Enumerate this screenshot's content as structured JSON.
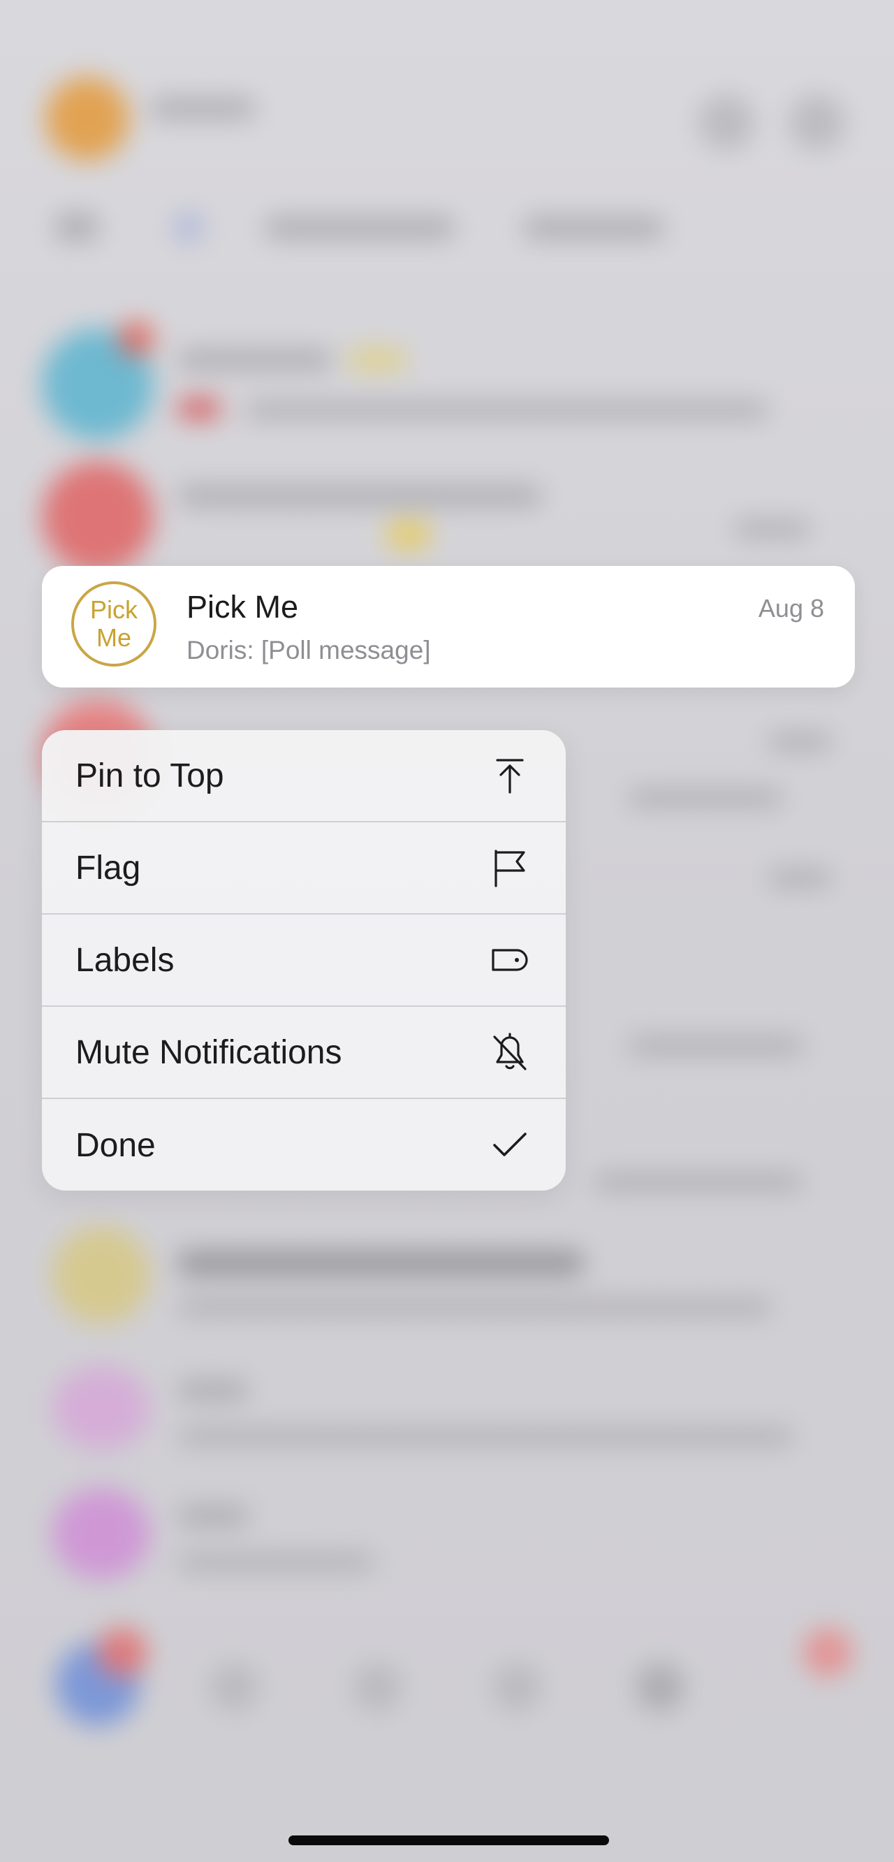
{
  "preview": {
    "avatar_line1": "Pick",
    "avatar_line2": "Me",
    "name": "Pick Me",
    "date": "Aug 8",
    "subtitle": "Doris: [Poll message]"
  },
  "menu": {
    "items": [
      {
        "label": "Pin to Top",
        "icon": "pin-to-top-icon"
      },
      {
        "label": "Flag",
        "icon": "flag-icon"
      },
      {
        "label": "Labels",
        "icon": "label-tag-icon"
      },
      {
        "label": "Mute Notifications",
        "icon": "bell-slash-icon"
      },
      {
        "label": "Done",
        "icon": "checkmark-icon"
      }
    ]
  },
  "colors": {
    "avatar_accent": "#c9a646",
    "text_primary": "#1c1c1e",
    "text_secondary": "#8e8e93",
    "menu_background": "#f3f2f4",
    "backdrop": "#d3d2d7"
  }
}
